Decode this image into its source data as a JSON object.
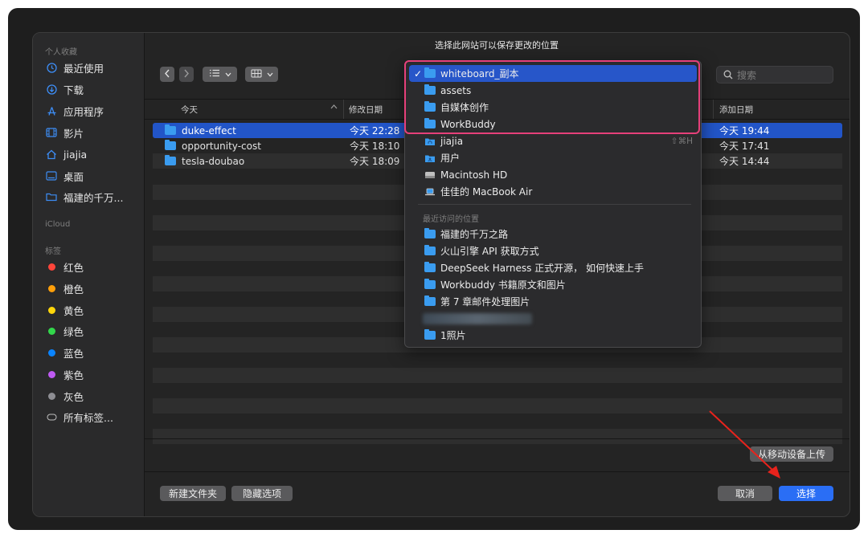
{
  "dialog": {
    "title": "选择此网站可以保存更改的位置",
    "search_placeholder": "搜索"
  },
  "sidebar": {
    "favorites_label": "个人收藏",
    "favorites": [
      {
        "label": "最近使用",
        "icon": "clock-icon"
      },
      {
        "label": "下载",
        "icon": "download-icon"
      },
      {
        "label": "应用程序",
        "icon": "applications-icon"
      },
      {
        "label": "影片",
        "icon": "film-icon"
      },
      {
        "label": "jiajia",
        "icon": "home-icon"
      },
      {
        "label": "桌面",
        "icon": "desktop-icon"
      },
      {
        "label": "福建的千万...",
        "icon": "folder-icon"
      }
    ],
    "icloud_label": "iCloud",
    "tags_label": "标签",
    "tags": [
      {
        "label": "红色",
        "color": "#ff453a"
      },
      {
        "label": "橙色",
        "color": "#ff9f0a"
      },
      {
        "label": "黄色",
        "color": "#ffd60a"
      },
      {
        "label": "绿色",
        "color": "#32d74b"
      },
      {
        "label": "蓝色",
        "color": "#0a84ff"
      },
      {
        "label": "紫色",
        "color": "#bf5af2"
      },
      {
        "label": "灰色",
        "color": "#8e8e93"
      }
    ],
    "all_tags": "所有标签..."
  },
  "columns": {
    "name": "今天",
    "modified": "修改日期",
    "added": "添加日期"
  },
  "files": [
    {
      "name": "duke-effect",
      "modified": "今天 22:28",
      "added": "今天 19:44"
    },
    {
      "name": "opportunity-cost",
      "modified": "今天 18:10",
      "added": "今天 17:41"
    },
    {
      "name": "tesla-doubao",
      "modified": "今天 18:09",
      "added": "今天 14:44"
    }
  ],
  "popup": {
    "items": [
      {
        "label": "whiteboard_副本",
        "icon": "folder-icon"
      },
      {
        "label": "assets",
        "icon": "folder-icon"
      },
      {
        "label": "自媒体创作",
        "icon": "folder-icon"
      },
      {
        "label": "WorkBuddy",
        "icon": "folder-icon"
      },
      {
        "label": "jiajia",
        "icon": "home-folder-icon",
        "shortcut": "⇧⌘H"
      },
      {
        "label": "用户",
        "icon": "users-folder-icon"
      },
      {
        "label": "Macintosh HD",
        "icon": "disk-icon"
      },
      {
        "label": "佳佳的 MacBook Air",
        "icon": "laptop-icon"
      }
    ],
    "recent_label": "最近访问的位置",
    "recent": [
      {
        "label": "福建的千万之路"
      },
      {
        "label": "火山引擎 API 获取方式"
      },
      {
        "label": "DeepSeek Harness 正式开源， 如何快速上手"
      },
      {
        "label": "Workbuddy 书籍原文和图片"
      },
      {
        "label": "第 7 章邮件处理图片"
      },
      {
        "label": ""
      },
      {
        "label": "1照片"
      }
    ]
  },
  "buttons": {
    "upload_from_device": "从移动设备上传",
    "new_folder": "新建文件夹",
    "hide_options": "隐藏选项",
    "cancel": "取消",
    "choose": "选择"
  },
  "accent_colors": {
    "selection": "#2255c8",
    "primary_button": "#2a6ef5",
    "annotation_highlight": "#e6407a",
    "annotation_arrow": "#e8231c"
  }
}
